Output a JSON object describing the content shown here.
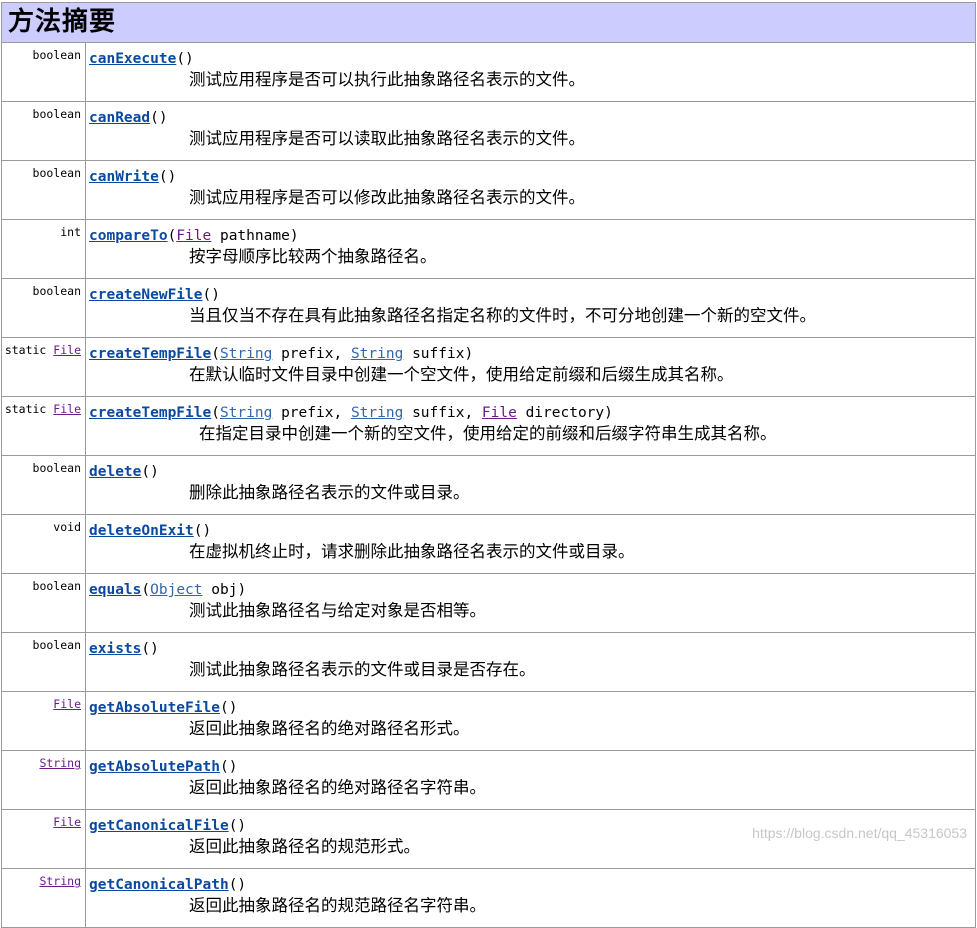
{
  "header": {
    "title": "方法摘要"
  },
  "methods": [
    {
      "modifier": "",
      "return_type": "boolean",
      "return_link": false,
      "name": "canExecute",
      "params": [],
      "description": "测试应用程序是否可以执行此抽象路径名表示的文件。"
    },
    {
      "modifier": "",
      "return_type": "boolean",
      "return_link": false,
      "name": "canRead",
      "params": [],
      "description": "测试应用程序是否可以读取此抽象路径名表示的文件。"
    },
    {
      "modifier": "",
      "return_type": "boolean",
      "return_link": false,
      "name": "canWrite",
      "params": [],
      "description": "测试应用程序是否可以修改此抽象路径名表示的文件。"
    },
    {
      "modifier": "",
      "return_type": "int",
      "return_link": false,
      "name": "compareTo",
      "params": [
        {
          "type": "File",
          "name": "pathname"
        }
      ],
      "description": "按字母顺序比较两个抽象路径名。"
    },
    {
      "modifier": "",
      "return_type": "boolean",
      "return_link": false,
      "name": "createNewFile",
      "params": [],
      "description": "当且仅当不存在具有此抽象路径名指定名称的文件时，不可分地创建一个新的空文件。"
    },
    {
      "modifier": "static",
      "return_type": "File",
      "return_link": true,
      "name": "createTempFile",
      "params": [
        {
          "type": "String",
          "name": "prefix"
        },
        {
          "type": "String",
          "name": "suffix"
        }
      ],
      "description": "在默认临时文件目录中创建一个空文件，使用给定前缀和后缀生成其名称。"
    },
    {
      "modifier": "static",
      "return_type": "File",
      "return_link": true,
      "name": "createTempFile",
      "params": [
        {
          "type": "String",
          "name": "prefix"
        },
        {
          "type": "String",
          "name": "suffix"
        },
        {
          "type": "File",
          "name": "directory"
        }
      ],
      "description": " 在指定目录中创建一个新的空文件，使用给定的前缀和后缀字符串生成其名称。"
    },
    {
      "modifier": "",
      "return_type": "boolean",
      "return_link": false,
      "name": "delete",
      "params": [],
      "description": "删除此抽象路径名表示的文件或目录。"
    },
    {
      "modifier": "",
      "return_type": "void",
      "return_link": false,
      "name": "deleteOnExit",
      "params": [],
      "description": "在虚拟机终止时，请求删除此抽象路径名表示的文件或目录。"
    },
    {
      "modifier": "",
      "return_type": "boolean",
      "return_link": false,
      "name": "equals",
      "params": [
        {
          "type": "Object",
          "name": "obj"
        }
      ],
      "description": "测试此抽象路径名与给定对象是否相等。"
    },
    {
      "modifier": "",
      "return_type": "boolean",
      "return_link": false,
      "name": "exists",
      "params": [],
      "description": "测试此抽象路径名表示的文件或目录是否存在。"
    },
    {
      "modifier": "",
      "return_type": "File",
      "return_link": true,
      "name": "getAbsoluteFile",
      "params": [],
      "description": "返回此抽象路径名的绝对路径名形式。"
    },
    {
      "modifier": "",
      "return_type": "String",
      "return_link": true,
      "name": "getAbsolutePath",
      "params": [],
      "description": "返回此抽象路径名的绝对路径名字符串。"
    },
    {
      "modifier": "",
      "return_type": "File",
      "return_link": true,
      "name": "getCanonicalFile",
      "params": [],
      "description": "返回此抽象路径名的规范形式。"
    },
    {
      "modifier": "",
      "return_type": "String",
      "return_link": true,
      "name": "getCanonicalPath",
      "params": [],
      "description": "返回此抽象路径名的规范路径名字符串。"
    }
  ],
  "watermark": "https://blog.csdn.net/qq_45316053"
}
